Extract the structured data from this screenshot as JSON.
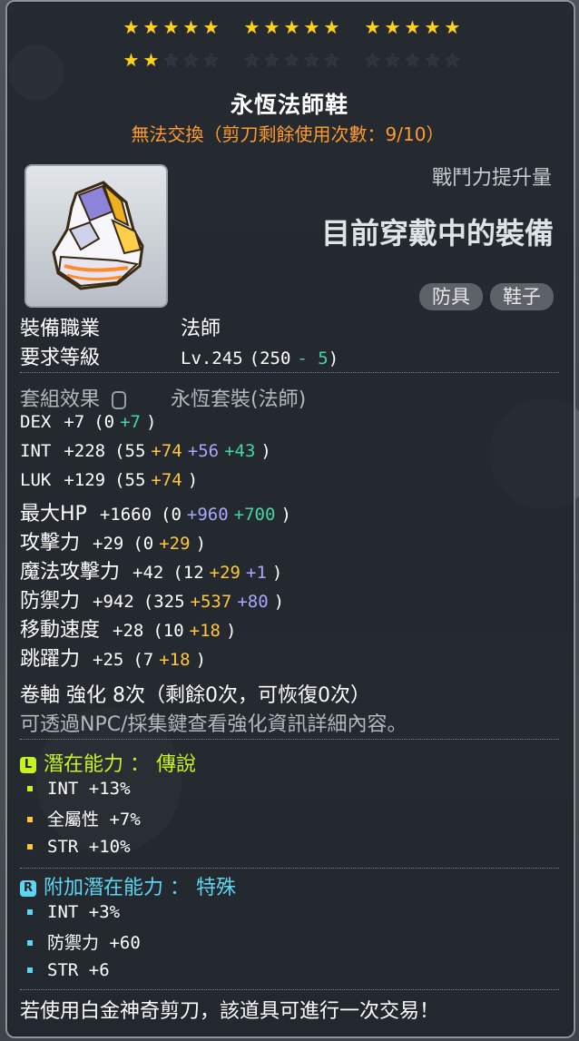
{
  "stars": {
    "groups": [
      {
        "on": 5,
        "off": 0
      },
      {
        "on": 5,
        "off": 0
      },
      {
        "on": 5,
        "off": 0
      },
      {
        "on": 2,
        "off": 3
      },
      {
        "on": 0,
        "off": 5
      },
      {
        "on": 0,
        "off": 5
      }
    ],
    "on_color": "#ffd21a",
    "off_color": "#2e3338"
  },
  "item": {
    "name": "永恆法師鞋",
    "trade_note": "無法交換（剪刀剩餘使用次數：9/10）",
    "icon": "boots-icon",
    "combat_power_label": "戰鬥力提升量",
    "equipped_text": "目前穿戴中的裝備",
    "tags": [
      "防具",
      "鞋子"
    ]
  },
  "requirements": {
    "job_label": "裝備職業",
    "job_value": "法師",
    "level_label": "要求等級",
    "level_text": "Lv.245",
    "level_base": "(250",
    "level_diff": "- 5",
    ")": ")"
  },
  "set": {
    "label": "套組效果",
    "value": "永恆套裝(法師)",
    "icon": "lock-icon"
  },
  "stats": [
    {
      "name": "DEX",
      "total": "+7",
      "parts": [
        {
          "t": "(0",
          "c": "white"
        },
        {
          "t": "+7",
          "c": "green"
        },
        {
          "t": ")",
          "c": "white"
        }
      ]
    },
    {
      "name": "INT",
      "total": "+228",
      "parts": [
        {
          "t": "(55",
          "c": "white"
        },
        {
          "t": "+74",
          "c": "yellow"
        },
        {
          "t": "+56",
          "c": "purple"
        },
        {
          "t": "+43",
          "c": "green"
        },
        {
          "t": ")",
          "c": "white"
        }
      ]
    },
    {
      "name": "LUK",
      "total": "+129",
      "parts": [
        {
          "t": "(55",
          "c": "white"
        },
        {
          "t": "+74",
          "c": "yellow"
        },
        {
          "t": ")",
          "c": "white"
        }
      ]
    },
    {
      "name": "最大HP",
      "total": "+1660",
      "parts": [
        {
          "t": "(0",
          "c": "white"
        },
        {
          "t": "+960",
          "c": "purple"
        },
        {
          "t": "+700",
          "c": "green"
        },
        {
          "t": ")",
          "c": "white"
        }
      ]
    },
    {
      "name": "攻擊力",
      "total": "+29",
      "parts": [
        {
          "t": "(0",
          "c": "white"
        },
        {
          "t": "+29",
          "c": "yellow"
        },
        {
          "t": ")",
          "c": "white"
        }
      ]
    },
    {
      "name": "魔法攻擊力",
      "total": "+42",
      "parts": [
        {
          "t": "(12",
          "c": "white"
        },
        {
          "t": "+29",
          "c": "yellow"
        },
        {
          "t": "+1",
          "c": "purple"
        },
        {
          "t": ")",
          "c": "white"
        }
      ]
    },
    {
      "name": "防禦力",
      "total": "+942",
      "parts": [
        {
          "t": "(325",
          "c": "white"
        },
        {
          "t": "+537",
          "c": "yellow"
        },
        {
          "t": "+80",
          "c": "purple"
        },
        {
          "t": ")",
          "c": "white"
        }
      ]
    },
    {
      "name": "移動速度",
      "total": "+28",
      "parts": [
        {
          "t": "(10",
          "c": "white"
        },
        {
          "t": "+18",
          "c": "yellow"
        },
        {
          "t": ")",
          "c": "white"
        }
      ]
    },
    {
      "name": "跳躍力",
      "total": "+25",
      "parts": [
        {
          "t": "(7",
          "c": "white"
        },
        {
          "t": "+18",
          "c": "yellow"
        },
        {
          "t": ")",
          "c": "white"
        }
      ]
    }
  ],
  "scroll": {
    "line": "卷軸 強化 8次（剩餘0次，可恢復0次）",
    "hint": "可透過NPC/採集鍵查看強化資訊詳細內容。"
  },
  "potential": {
    "badge": "L",
    "title": "潛在能力 ： 傳說",
    "badge_color": "#c5f224",
    "lines": [
      "INT +13%",
      "全屬性 +7%",
      "STR +10%"
    ],
    "bullet_colors": [
      "#c5f224",
      "#ffc63a",
      "#ffc63a"
    ]
  },
  "additional": {
    "badge": "R",
    "title": "附加潛在能力 ： 特殊",
    "badge_color": "#5fd4f0",
    "lines": [
      "INT +3%",
      "防禦力 +60",
      "STR +6"
    ],
    "bullet_colors": [
      "#5fd4f0",
      "#5fd4f0",
      "#5fd4f0"
    ]
  },
  "footer": "若使用白金神奇剪刀，該道具可進行一次交易！"
}
